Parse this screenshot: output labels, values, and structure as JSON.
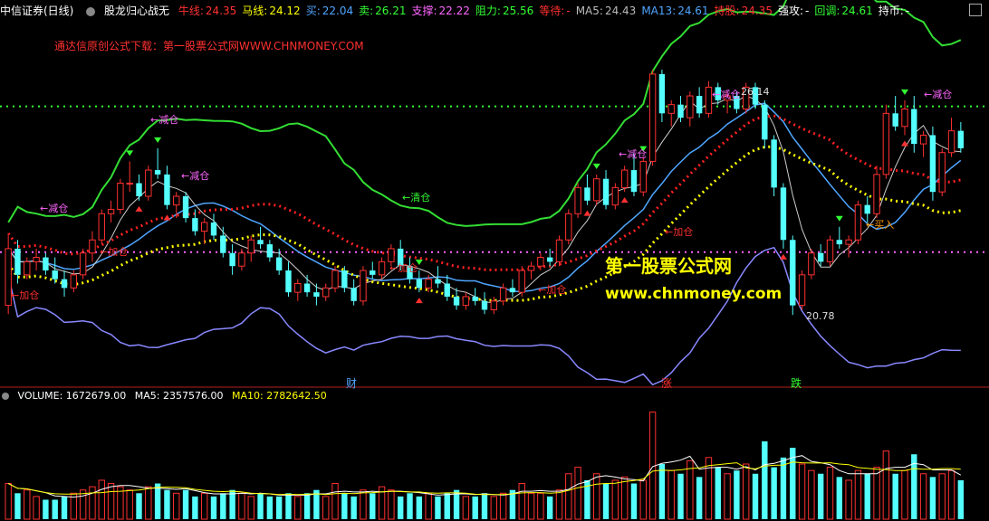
{
  "header": {
    "stock": "中信证券(日线)",
    "formula": "股龙归心战无",
    "items": [
      {
        "label": "牛线:",
        "value": "24.35",
        "color": "#ff3030"
      },
      {
        "label": "马线:",
        "value": "24.12",
        "color": "#ffff00"
      },
      {
        "label": "买:",
        "value": "22.04",
        "color": "#4fa6ff"
      },
      {
        "label": "卖:",
        "value": "26.21",
        "color": "#33ff33"
      },
      {
        "label": "支撑:",
        "value": "22.22",
        "color": "#ff66ff"
      },
      {
        "label": "阻力:",
        "value": "25.56",
        "color": "#33ff33"
      },
      {
        "label": "等待:",
        "value": "-",
        "color": "#ff3030"
      },
      {
        "label": "MA5:",
        "value": "24.43",
        "color": "#bbbbbb"
      },
      {
        "label": "MA13:",
        "value": "24.61",
        "color": "#4fa6ff"
      },
      {
        "label": "持股:",
        "value": "24.35",
        "color": "#ff3030"
      },
      {
        "label": "强攻:",
        "value": "-",
        "color": "#ffffff"
      },
      {
        "label": "回调:",
        "value": "24.61",
        "color": "#33ff33"
      },
      {
        "label": "持币:",
        "value": "-",
        "color": "#ffffff"
      }
    ]
  },
  "download_note": "通达信原创公式下载：第一股票公式网WWW.CHNMONEY.COM",
  "watermark": {
    "line1": "第一股票公式网",
    "line2": "www.chnmoney.com"
  },
  "annotations": [
    {
      "text": "←减仓",
      "kind": "pink"
    },
    {
      "text": "←减仓",
      "kind": "pink"
    },
    {
      "text": "←清仓",
      "kind": "green"
    },
    {
      "text": "←减仓",
      "kind": "pink"
    },
    {
      "text": "←减仓",
      "kind": "pink"
    },
    {
      "text": "←减仓",
      "kind": "pink"
    },
    {
      "text": "←减仓",
      "kind": "pink"
    },
    {
      "text": "←加仓",
      "kind": "red"
    },
    {
      "text": "←加仓",
      "kind": "red"
    },
    {
      "text": "←加仓",
      "kind": "red"
    },
    {
      "text": "←加仓",
      "kind": "red"
    },
    {
      "text": "←加仓",
      "kind": "red"
    },
    {
      "text": "←买入",
      "kind": "orange"
    },
    {
      "text": "26.14",
      "kind": "white"
    },
    {
      "text": "20.78",
      "kind": "white"
    }
  ],
  "events": [
    {
      "text": "财",
      "color": "#4fa6ff"
    },
    {
      "text": "涨",
      "color": "#ff3030"
    },
    {
      "text": "跌",
      "color": "#33ff33"
    }
  ],
  "volume_header": {
    "volume_label": "VOLUME:",
    "volume": "1672679.00",
    "ma5_label": "MA5:",
    "ma5": "2357576.00",
    "ma10_label": "MA10:",
    "ma10": "2782642.50"
  },
  "chart_data": [
    {
      "type": "candlestick",
      "title": "中信证券(日线)",
      "ylim": [
        19.5,
        27.5
      ],
      "levels": {
        "resistance": 25.56,
        "support": 22.22
      },
      "candles": [
        [
          21.0,
          22.6,
          20.8,
          22.3
        ],
        [
          22.3,
          22.5,
          21.5,
          21.7
        ],
        [
          21.7,
          22.1,
          21.6,
          22.0
        ],
        [
          22.0,
          22.3,
          21.8,
          22.1
        ],
        [
          22.1,
          22.2,
          21.7,
          21.8
        ],
        [
          21.8,
          22.1,
          21.5,
          21.6
        ],
        [
          21.6,
          21.8,
          21.2,
          21.4
        ],
        [
          21.4,
          21.8,
          21.3,
          21.7
        ],
        [
          21.7,
          22.3,
          21.6,
          22.2
        ],
        [
          22.2,
          22.7,
          22.0,
          22.5
        ],
        [
          22.5,
          23.2,
          22.4,
          23.1
        ],
        [
          23.1,
          23.4,
          22.9,
          23.2
        ],
        [
          23.2,
          23.9,
          23.1,
          23.8
        ],
        [
          23.8,
          24.3,
          23.6,
          23.8
        ],
        [
          23.8,
          24.0,
          23.4,
          23.5
        ],
        [
          23.5,
          24.2,
          23.4,
          24.1
        ],
        [
          24.1,
          24.6,
          23.9,
          24.0
        ],
        [
          24.0,
          24.2,
          23.2,
          23.3
        ],
        [
          23.3,
          23.6,
          23.0,
          23.5
        ],
        [
          23.5,
          23.6,
          22.9,
          23.0
        ],
        [
          23.0,
          23.2,
          22.6,
          22.7
        ],
        [
          22.7,
          23.0,
          22.4,
          22.9
        ],
        [
          22.9,
          23.1,
          22.5,
          22.6
        ],
        [
          22.6,
          22.8,
          22.1,
          22.2
        ],
        [
          22.2,
          22.4,
          21.7,
          21.9
        ],
        [
          21.9,
          22.3,
          21.8,
          22.2
        ],
        [
          22.2,
          22.6,
          22.0,
          22.5
        ],
        [
          22.5,
          22.8,
          22.3,
          22.4
        ],
        [
          22.4,
          22.5,
          22.0,
          22.1
        ],
        [
          22.1,
          22.3,
          21.7,
          21.8
        ],
        [
          21.8,
          22.0,
          21.2,
          21.3
        ],
        [
          21.3,
          21.6,
          21.1,
          21.5
        ],
        [
          21.5,
          21.7,
          21.2,
          21.3
        ],
        [
          21.3,
          21.5,
          21.0,
          21.2
        ],
        [
          21.2,
          21.5,
          21.1,
          21.4
        ],
        [
          21.4,
          21.9,
          21.3,
          21.8
        ],
        [
          21.8,
          21.9,
          21.3,
          21.4
        ],
        [
          21.4,
          21.6,
          21.0,
          21.1
        ],
        [
          21.1,
          21.9,
          21.0,
          21.8
        ],
        [
          21.8,
          22.0,
          21.6,
          21.7
        ],
        [
          21.7,
          22.1,
          21.6,
          22.0
        ],
        [
          22.0,
          22.4,
          21.9,
          22.3
        ],
        [
          22.3,
          22.5,
          21.8,
          21.9
        ],
        [
          21.9,
          22.1,
          21.5,
          21.6
        ],
        [
          21.6,
          21.8,
          21.3,
          21.4
        ],
        [
          21.4,
          21.7,
          21.3,
          21.6
        ],
        [
          21.6,
          21.9,
          21.4,
          21.5
        ],
        [
          21.5,
          21.7,
          21.1,
          21.2
        ],
        [
          21.2,
          21.4,
          20.9,
          21.0
        ],
        [
          21.0,
          21.3,
          20.9,
          21.2
        ],
        [
          21.2,
          21.4,
          21.0,
          21.1
        ],
        [
          21.1,
          21.3,
          20.8,
          20.9
        ],
        [
          20.9,
          21.2,
          20.8,
          21.1
        ],
        [
          21.1,
          21.5,
          21.0,
          21.4
        ],
        [
          21.4,
          21.6,
          21.2,
          21.3
        ],
        [
          21.3,
          21.9,
          21.2,
          21.8
        ],
        [
          21.8,
          22.0,
          21.6,
          21.9
        ],
        [
          21.9,
          22.2,
          21.8,
          22.1
        ],
        [
          22.1,
          22.3,
          21.9,
          22.0
        ],
        [
          22.0,
          22.6,
          21.9,
          22.5
        ],
        [
          22.5,
          23.2,
          22.4,
          23.1
        ],
        [
          23.1,
          23.8,
          23.0,
          23.7
        ],
        [
          23.7,
          24.0,
          23.3,
          23.4
        ],
        [
          23.4,
          24.0,
          23.3,
          23.9
        ],
        [
          23.9,
          24.1,
          23.2,
          23.3
        ],
        [
          23.3,
          23.8,
          23.2,
          23.7
        ],
        [
          23.7,
          24.2,
          23.6,
          24.1
        ],
        [
          24.1,
          24.5,
          23.5,
          23.6
        ],
        [
          23.6,
          24.4,
          23.5,
          24.3
        ],
        [
          24.3,
          26.4,
          24.2,
          26.3
        ],
        [
          26.3,
          26.4,
          25.2,
          25.4
        ],
        [
          25.4,
          25.7,
          25.1,
          25.6
        ],
        [
          25.6,
          25.8,
          25.2,
          25.3
        ],
        [
          25.3,
          25.9,
          25.1,
          25.8
        ],
        [
          25.8,
          26.0,
          25.3,
          25.4
        ],
        [
          25.4,
          26.14,
          25.3,
          26.0
        ],
        [
          26.0,
          26.1,
          25.6,
          25.7
        ],
        [
          25.7,
          25.9,
          25.4,
          25.8
        ],
        [
          25.8,
          25.9,
          25.4,
          25.5
        ],
        [
          25.5,
          26.1,
          25.4,
          26.0
        ],
        [
          26.0,
          26.1,
          25.5,
          25.6
        ],
        [
          25.6,
          25.7,
          24.6,
          24.8
        ],
        [
          24.8,
          24.9,
          23.5,
          23.7
        ],
        [
          23.7,
          23.8,
          22.3,
          22.5
        ],
        [
          22.5,
          22.6,
          20.78,
          21.0
        ],
        [
          21.0,
          21.8,
          20.9,
          21.7
        ],
        [
          21.7,
          22.3,
          21.6,
          22.2
        ],
        [
          22.2,
          22.4,
          21.9,
          22.0
        ],
        [
          22.0,
          22.6,
          21.9,
          22.5
        ],
        [
          22.5,
          22.8,
          22.3,
          22.4
        ],
        [
          22.4,
          22.6,
          22.1,
          22.5
        ],
        [
          22.5,
          23.4,
          22.4,
          23.3
        ],
        [
          23.3,
          23.5,
          22.9,
          23.1
        ],
        [
          23.1,
          24.2,
          23.0,
          24.0
        ],
        [
          24.0,
          25.6,
          23.9,
          25.4
        ],
        [
          25.4,
          25.8,
          25.0,
          25.1
        ],
        [
          25.1,
          25.7,
          24.9,
          25.5
        ],
        [
          25.5,
          25.8,
          24.5,
          24.7
        ],
        [
          24.7,
          25.0,
          24.4,
          24.9
        ],
        [
          24.9,
          25.1,
          23.4,
          23.6
        ],
        [
          23.6,
          24.6,
          23.5,
          24.5
        ],
        [
          24.5,
          25.3,
          24.4,
          25.0
        ],
        [
          25.0,
          25.2,
          24.5,
          24.6
        ]
      ]
    },
    {
      "type": "bar",
      "title": "VOLUME",
      "values": [
        0.55,
        0.4,
        0.45,
        0.35,
        0.3,
        0.3,
        0.35,
        0.4,
        0.45,
        0.5,
        0.6,
        0.55,
        0.5,
        0.45,
        0.4,
        0.5,
        0.55,
        0.45,
        0.4,
        0.45,
        0.35,
        0.4,
        0.35,
        0.4,
        0.45,
        0.4,
        0.35,
        0.4,
        0.35,
        0.35,
        0.4,
        0.35,
        0.4,
        0.45,
        0.35,
        0.55,
        0.4,
        0.35,
        0.45,
        0.4,
        0.5,
        0.45,
        0.35,
        0.4,
        0.35,
        0.4,
        0.35,
        0.4,
        0.45,
        0.35,
        0.35,
        0.4,
        0.35,
        0.4,
        0.45,
        0.55,
        0.4,
        0.4,
        0.35,
        0.45,
        0.7,
        0.8,
        0.6,
        0.7,
        0.55,
        0.6,
        0.65,
        0.55,
        0.6,
        1.65,
        0.85,
        0.75,
        0.7,
        0.9,
        0.65,
        0.95,
        0.8,
        0.7,
        0.75,
        0.85,
        0.7,
        1.2,
        0.8,
        0.95,
        1.1,
        0.85,
        0.75,
        0.7,
        0.8,
        0.65,
        0.6,
        0.75,
        0.7,
        0.8,
        1.05,
        0.7,
        0.75,
        1.0,
        0.7,
        0.65,
        0.7,
        0.75,
        0.6
      ]
    }
  ]
}
